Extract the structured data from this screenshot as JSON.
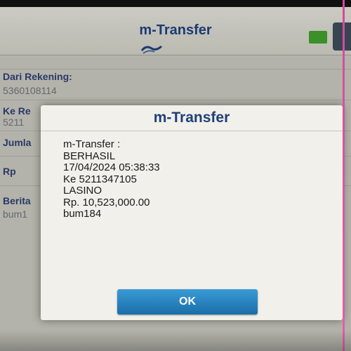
{
  "app": {
    "title": "m-Transfer"
  },
  "form": {
    "source_account_label": "Dari Rekening:",
    "source_account_value": "5360108114",
    "destination_label_partial": "Ke Re",
    "destination_value_partial": "5211",
    "amount_label_partial": "Jumla",
    "currency_label": "Rp",
    "note_label_partial": "Berita",
    "note_value_partial": "bum1"
  },
  "dialog": {
    "title": "m-Transfer",
    "lines": [
      "m-Transfer :",
      "BERHASIL",
      "17/04/2024 05:38:33",
      "Ke 5211347105",
      "LASINO",
      "Rp. 10,523,000.00",
      "bum184"
    ],
    "ok_label": "OK"
  },
  "colors": {
    "title_blue": "#1f3f7a",
    "ok_button": "#1a6ea8",
    "header_indicator_green": "#3f9a2a"
  },
  "icons": {
    "header_logo": "bank-logo-icon"
  }
}
